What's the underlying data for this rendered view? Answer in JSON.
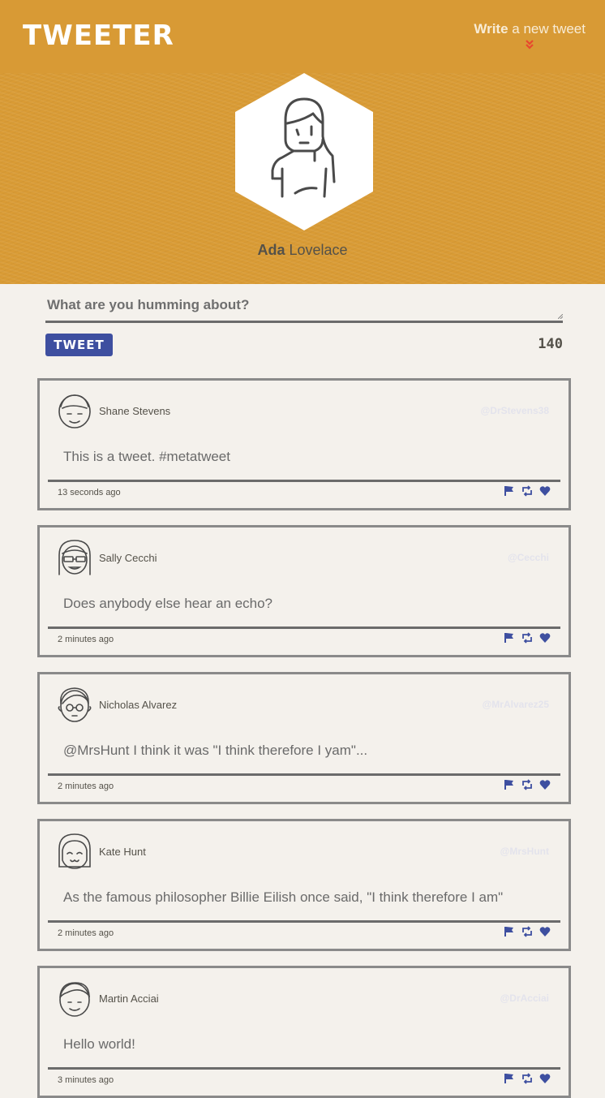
{
  "nav": {
    "logo": "TWEETER",
    "compose_bold": "Write",
    "compose_rest": " a new tweet"
  },
  "profile": {
    "first_name": "Ada",
    "last_name": " Lovelace"
  },
  "compose": {
    "placeholder": "What are you humming about?",
    "button_label": "TWEET",
    "char_count": "140"
  },
  "tweets": [
    {
      "name": "Shane Stevens",
      "handle": "@DrStevens38",
      "text": "This is a tweet. #metatweet",
      "time": "13 seconds ago"
    },
    {
      "name": "Sally Cecchi",
      "handle": "@Cecchi",
      "text": "Does anybody else hear an echo?",
      "time": "2 minutes ago"
    },
    {
      "name": "Nicholas Alvarez",
      "handle": "@MrAlvarez25",
      "text": "@MrsHunt I think it was \"I think therefore I yam\"...",
      "time": "2 minutes ago"
    },
    {
      "name": "Kate Hunt",
      "handle": "@MrsHunt",
      "text": "As the famous philosopher Billie Eilish once said, \"I think therefore I am\"",
      "time": "2 minutes ago"
    },
    {
      "name": "Martin Acciai",
      "handle": "@DrAcciai",
      "text": "Hello world!",
      "time": "3 minutes ago"
    }
  ],
  "colors": {
    "nav_bg": "#d89a35",
    "accent": "#3e4fa0",
    "page_bg": "#f4f1ec"
  }
}
